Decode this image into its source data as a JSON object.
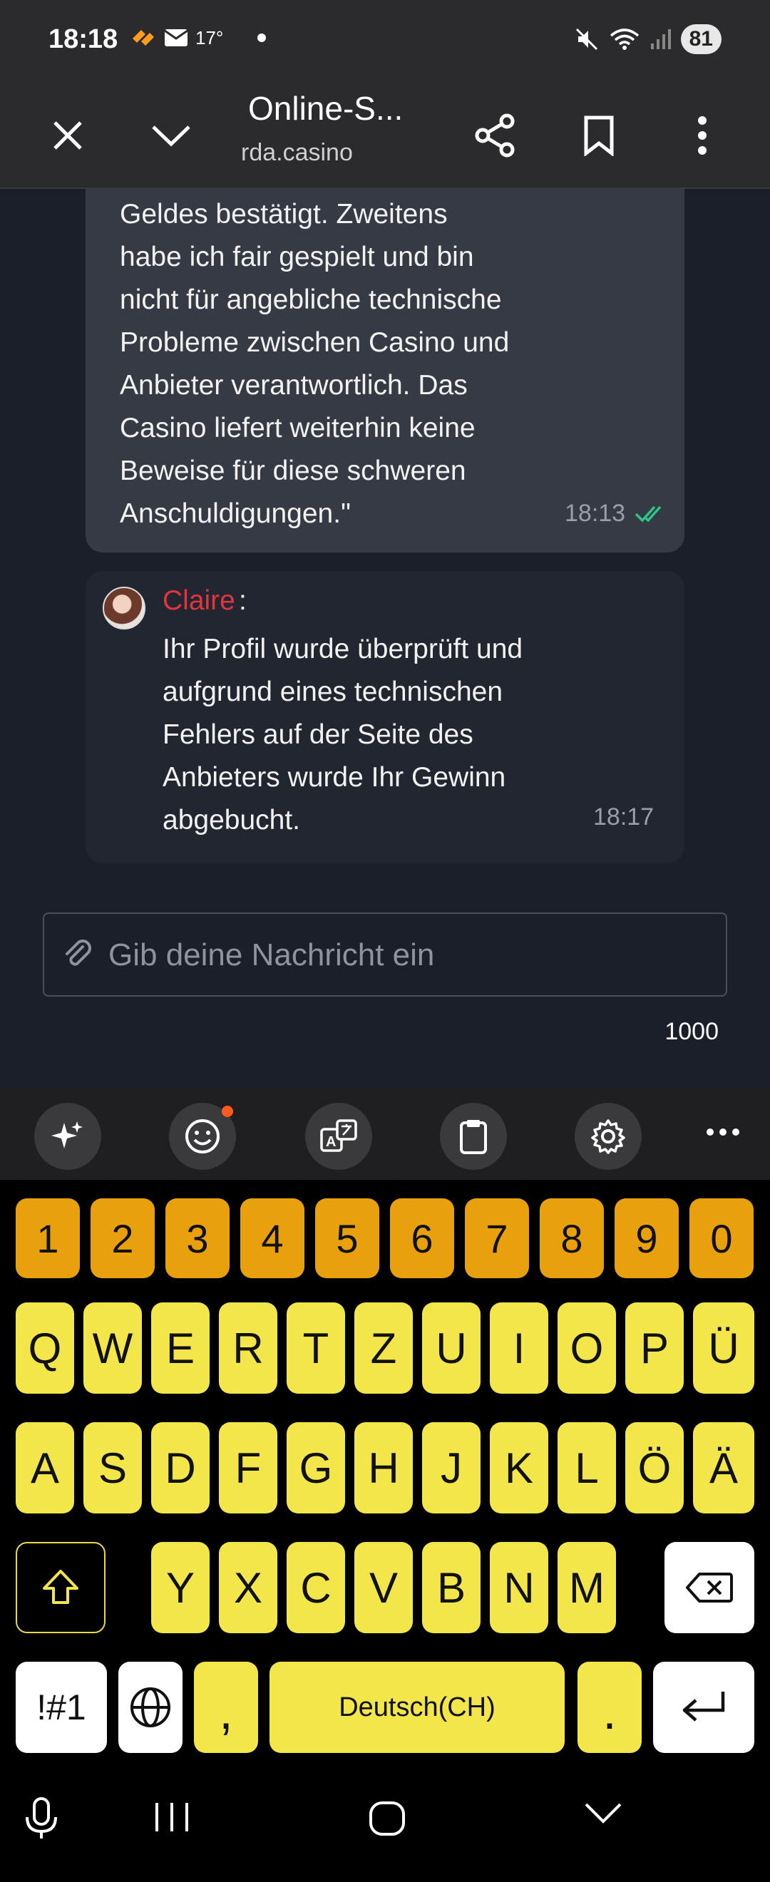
{
  "status_bar": {
    "time": "18:18",
    "temperature": "17°",
    "battery": "81"
  },
  "browser": {
    "title": "Online-S...",
    "url": "rda.casino",
    "icons": [
      "close-icon",
      "chevron-down-icon",
      "share-icon",
      "bookmark-icon",
      "more-vert-icon"
    ]
  },
  "chat": {
    "user_message": {
      "lines": [
        "Geldes bestätigt. Zweitens",
        "habe ich fair gespielt und bin",
        "nicht für angebliche technische",
        "Probleme zwischen Casino und",
        "Anbieter verantwortlich. Das",
        "Casino liefert weiterhin keine",
        "Beweise für diese schweren",
        "Anschuldigungen.\""
      ],
      "time": "18:13"
    },
    "agent_message": {
      "name": "Claire",
      "colon": ":",
      "lines": [
        "Ihr Profil wurde überprüft und",
        "aufgrund eines technischen",
        "Fehlers auf der Seite des",
        "Anbieters wurde Ihr Gewinn",
        "abgebucht."
      ],
      "time": "18:17"
    }
  },
  "input": {
    "placeholder": "Gib deine Nachricht ein",
    "char_count": "1000"
  },
  "keyboard": {
    "toolbar_icons": [
      "sparkle-icon",
      "emoji-icon",
      "translate-icon",
      "clipboard-icon",
      "settings-icon",
      "more-horiz-icon"
    ],
    "number_row": [
      "1",
      "2",
      "3",
      "4",
      "5",
      "6",
      "7",
      "8",
      "9",
      "0"
    ],
    "row1": [
      "Q",
      "W",
      "E",
      "R",
      "T",
      "Z",
      "U",
      "I",
      "O",
      "P",
      "Ü"
    ],
    "row2": [
      "A",
      "S",
      "D",
      "F",
      "G",
      "H",
      "J",
      "K",
      "L",
      "Ö",
      "Ä"
    ],
    "row3": [
      "Y",
      "X",
      "C",
      "V",
      "B",
      "N",
      "M"
    ],
    "symbols_label": "!#1",
    "comma": ",",
    "space_label": "Deutsch(CH)",
    "period": ".",
    "colors": {
      "number_keys": "#e8a10c",
      "letter_keys": "#f2e64a"
    }
  },
  "nav_bar": {
    "icons": [
      "mic-icon",
      "recent-apps-icon",
      "home-icon",
      "hide-keyboard-icon"
    ]
  }
}
